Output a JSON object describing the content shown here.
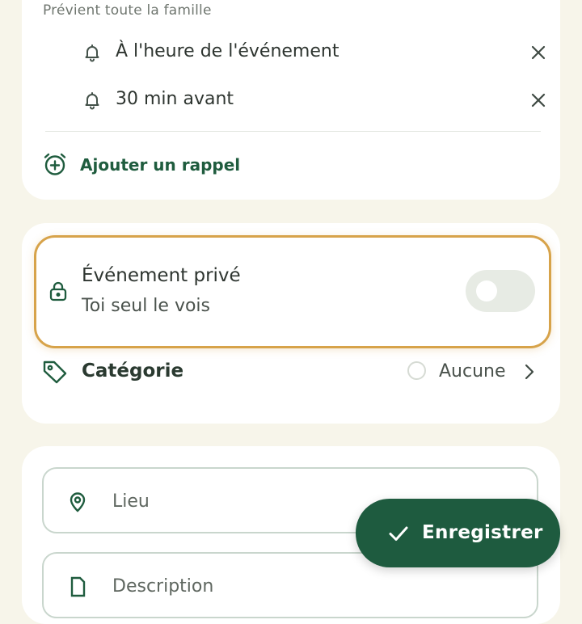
{
  "reminders": {
    "subtitle": "Prévient toute la famille",
    "items": [
      {
        "label": "À l'heure de l'événement",
        "icon": "bell-icon"
      },
      {
        "label": "30 min avant",
        "icon": "bell-icon"
      }
    ],
    "add_label": "Ajouter un rappel"
  },
  "private_event": {
    "title": "Événement privé",
    "subtitle": "Toi seul le vois",
    "enabled": false
  },
  "category": {
    "label": "Catégorie",
    "value": "Aucune"
  },
  "location": {
    "placeholder": "Lieu"
  },
  "description": {
    "placeholder": "Description"
  },
  "save_button": {
    "label": "Enregistrer"
  },
  "colors": {
    "accent": "#1e5b3f",
    "highlight": "#d7a34a",
    "background": "#f7f5ea"
  }
}
